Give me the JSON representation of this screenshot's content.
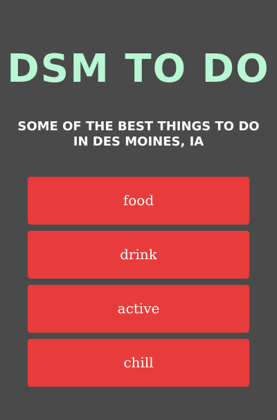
{
  "header": {
    "title": "DSM TO DO",
    "subtitle": "SOME OF THE BEST THINGS TO DO IN DES MOINES, IA"
  },
  "menu": {
    "items": [
      {
        "label": "food"
      },
      {
        "label": "drink"
      },
      {
        "label": "active"
      },
      {
        "label": "chill"
      }
    ]
  },
  "colors": {
    "background": "#4a4a4a",
    "title": "#b8f7d3",
    "button": "#e83c3c",
    "text": "#ffffff"
  }
}
